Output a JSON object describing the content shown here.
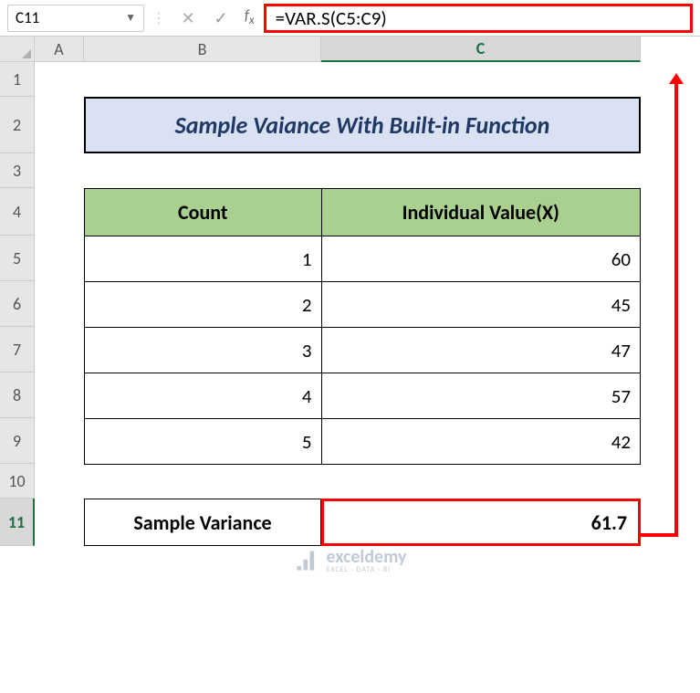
{
  "name_box": "C11",
  "formula": "=VAR.S(C5:C9)",
  "columns": {
    "A": "A",
    "B": "B",
    "C": "C"
  },
  "rows": {
    "1": "1",
    "2": "2",
    "3": "3",
    "4": "4",
    "5": "5",
    "6": "6",
    "7": "7",
    "8": "8",
    "9": "9",
    "10": "10",
    "11": "11"
  },
  "title": "Sample Vaiance With Built-in Function",
  "headers": {
    "count": "Count",
    "value": "Individual Value(X)"
  },
  "data": [
    {
      "count": "1",
      "value": "60"
    },
    {
      "count": "2",
      "value": "45"
    },
    {
      "count": "3",
      "value": "47"
    },
    {
      "count": "4",
      "value": "57"
    },
    {
      "count": "5",
      "value": "42"
    }
  ],
  "result": {
    "label": "Sample Variance",
    "value": "61.7"
  },
  "watermark": {
    "name": "exceldemy",
    "tag": "EXCEL · DATA · BI"
  }
}
